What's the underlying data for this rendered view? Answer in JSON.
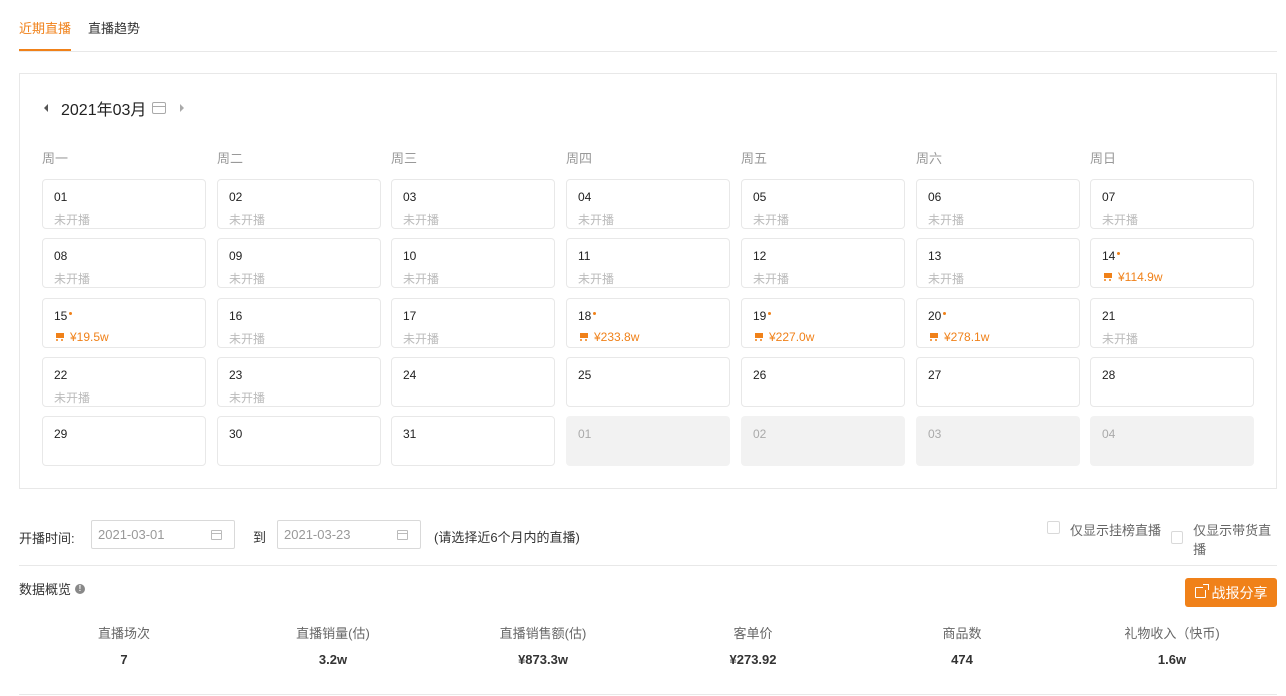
{
  "tabs": [
    "近期直播",
    "直播趋势"
  ],
  "calendar": {
    "month_label": "2021年03月",
    "weekdays": [
      "周一",
      "周二",
      "周三",
      "周四",
      "周五",
      "周六",
      "周日"
    ],
    "weeks": [
      [
        {
          "day": "01",
          "status": "未开播"
        },
        {
          "day": "02",
          "status": "未开播"
        },
        {
          "day": "03",
          "status": "未开播"
        },
        {
          "day": "04",
          "status": "未开播"
        },
        {
          "day": "05",
          "status": "未开播"
        },
        {
          "day": "06",
          "status": "未开播"
        },
        {
          "day": "07",
          "status": "未开播"
        }
      ],
      [
        {
          "day": "08",
          "status": "未开播"
        },
        {
          "day": "09",
          "status": "未开播"
        },
        {
          "day": "10",
          "status": "未开播"
        },
        {
          "day": "11",
          "status": "未开播"
        },
        {
          "day": "12",
          "status": "未开播"
        },
        {
          "day": "13",
          "status": "未开播"
        },
        {
          "day": "14",
          "sales": "¥114.9w",
          "live": true
        }
      ],
      [
        {
          "day": "15",
          "sales": "¥19.5w",
          "live": true
        },
        {
          "day": "16",
          "status": "未开播"
        },
        {
          "day": "17",
          "status": "未开播"
        },
        {
          "day": "18",
          "sales": "¥233.8w",
          "live": true
        },
        {
          "day": "19",
          "sales": "¥227.0w",
          "live": true
        },
        {
          "day": "20",
          "sales": "¥278.1w",
          "live": true
        },
        {
          "day": "21",
          "status": "未开播"
        }
      ],
      [
        {
          "day": "22",
          "status": "未开播"
        },
        {
          "day": "23",
          "status": "未开播"
        },
        {
          "day": "24"
        },
        {
          "day": "25"
        },
        {
          "day": "26"
        },
        {
          "day": "27"
        },
        {
          "day": "28"
        }
      ],
      [
        {
          "day": "29"
        },
        {
          "day": "30"
        },
        {
          "day": "31"
        },
        {
          "day": "01",
          "muted": true
        },
        {
          "day": "02",
          "muted": true
        },
        {
          "day": "03",
          "muted": true
        },
        {
          "day": "04",
          "muted": true
        }
      ]
    ]
  },
  "filter": {
    "label": "开播时间:",
    "start_date": "2021-03-01",
    "to_label": "到",
    "end_date": "2021-03-23",
    "hint": "(请选择近6个月内的直播)",
    "checkbox_ranked": "仅显示挂榜直播",
    "checkbox_selling": "仅显示带货直播"
  },
  "overview": {
    "title": "数据概览",
    "share_label": "战报分享",
    "metrics": [
      {
        "label": "直播场次",
        "value": "7"
      },
      {
        "label": "直播销量(估)",
        "value": "3.2w"
      },
      {
        "label": "直播销售额(估)",
        "value": "¥873.3w"
      },
      {
        "label": "客单价",
        "value": "¥273.92"
      },
      {
        "label": "商品数",
        "value": "474"
      },
      {
        "label": "礼物收入（快币)",
        "value": "1.6w"
      }
    ]
  },
  "colors": {
    "accent": "#f08119",
    "muted_text": "#bbbbbb",
    "border": "#e8e8e8"
  }
}
